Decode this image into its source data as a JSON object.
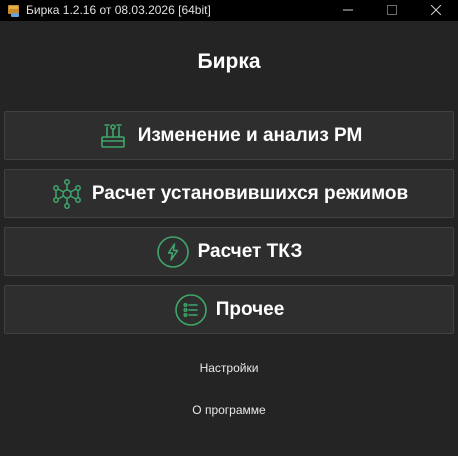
{
  "window": {
    "title": "Бирка 1.2.16 от 08.03.2026 [64bit]"
  },
  "main": {
    "title": "Бирка",
    "menu": [
      {
        "label": "Изменение и анализ РМ",
        "icon": "tools-workbench-icon"
      },
      {
        "label": "Расчет установившихся режимов",
        "icon": "network-graph-icon"
      },
      {
        "label": "Расчет ТКЗ",
        "icon": "lightning-icon"
      },
      {
        "label": "Прочее",
        "icon": "list-icon"
      }
    ],
    "settings_label": "Настройки",
    "about_label": "О программе"
  },
  "colors": {
    "accent": "#3fa66a",
    "background": "#242424",
    "button_background": "#2e2e2e",
    "titlebar": "#000000"
  }
}
